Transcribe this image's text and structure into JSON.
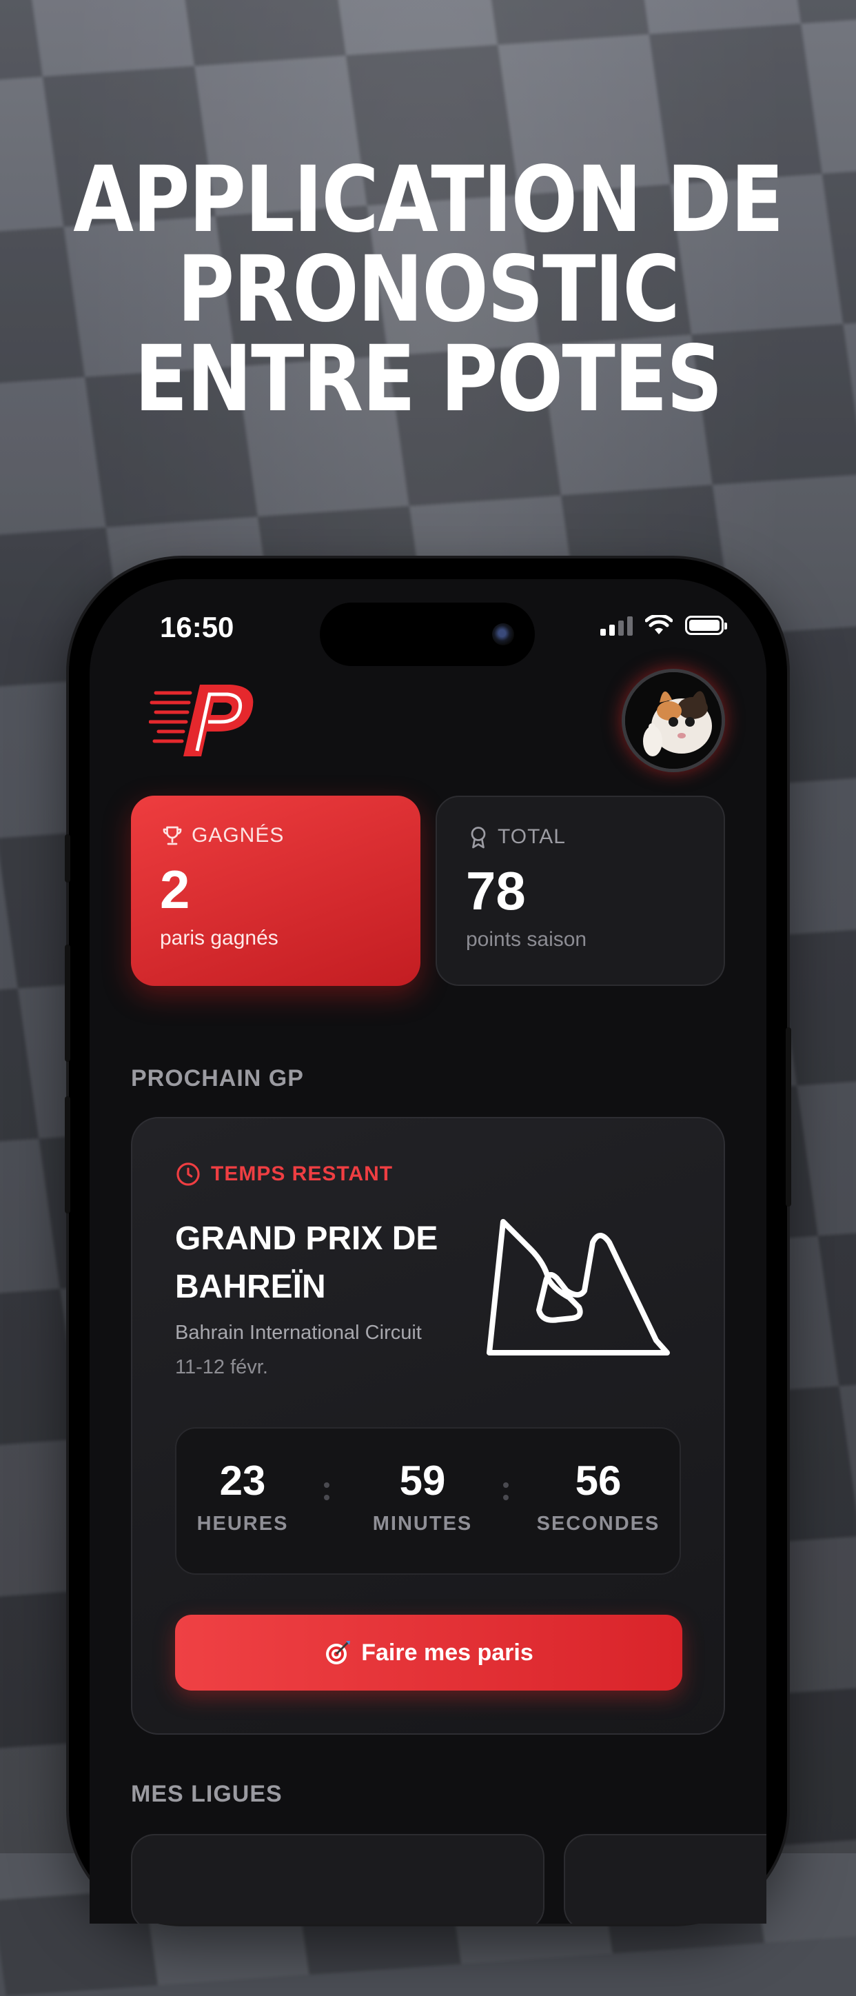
{
  "headline": {
    "line1": "APPLICATION DE",
    "line2": "PRONOSTIC",
    "line3": "ENTRE POTES"
  },
  "status_bar": {
    "time": "16:50"
  },
  "stats": {
    "won": {
      "label": "GAGNÉS",
      "value": "2",
      "sub": "paris gagnés",
      "icon": "trophy-icon"
    },
    "total": {
      "label": "TOTAL",
      "value": "78",
      "sub": "points saison",
      "icon": "medal-icon"
    }
  },
  "next_gp": {
    "section_title": "PROCHAIN GP",
    "time_left_label": "TEMPS RESTANT",
    "name_line1": "GRAND PRIX DE",
    "name_line2": "BAHREÏN",
    "circuit": "Bahrain International Circuit",
    "date": "11-12 févr.",
    "countdown": {
      "hours": "23",
      "hours_label": "HEURES",
      "minutes": "59",
      "minutes_label": "MINUTES",
      "seconds": "56",
      "seconds_label": "SECONDES"
    },
    "cta_label": "Faire mes paris"
  },
  "leagues": {
    "section_title": "MES LIGUES"
  },
  "colors": {
    "accent": "#e5282d",
    "card": "#1b1b1e",
    "background": "#0f0f11"
  }
}
